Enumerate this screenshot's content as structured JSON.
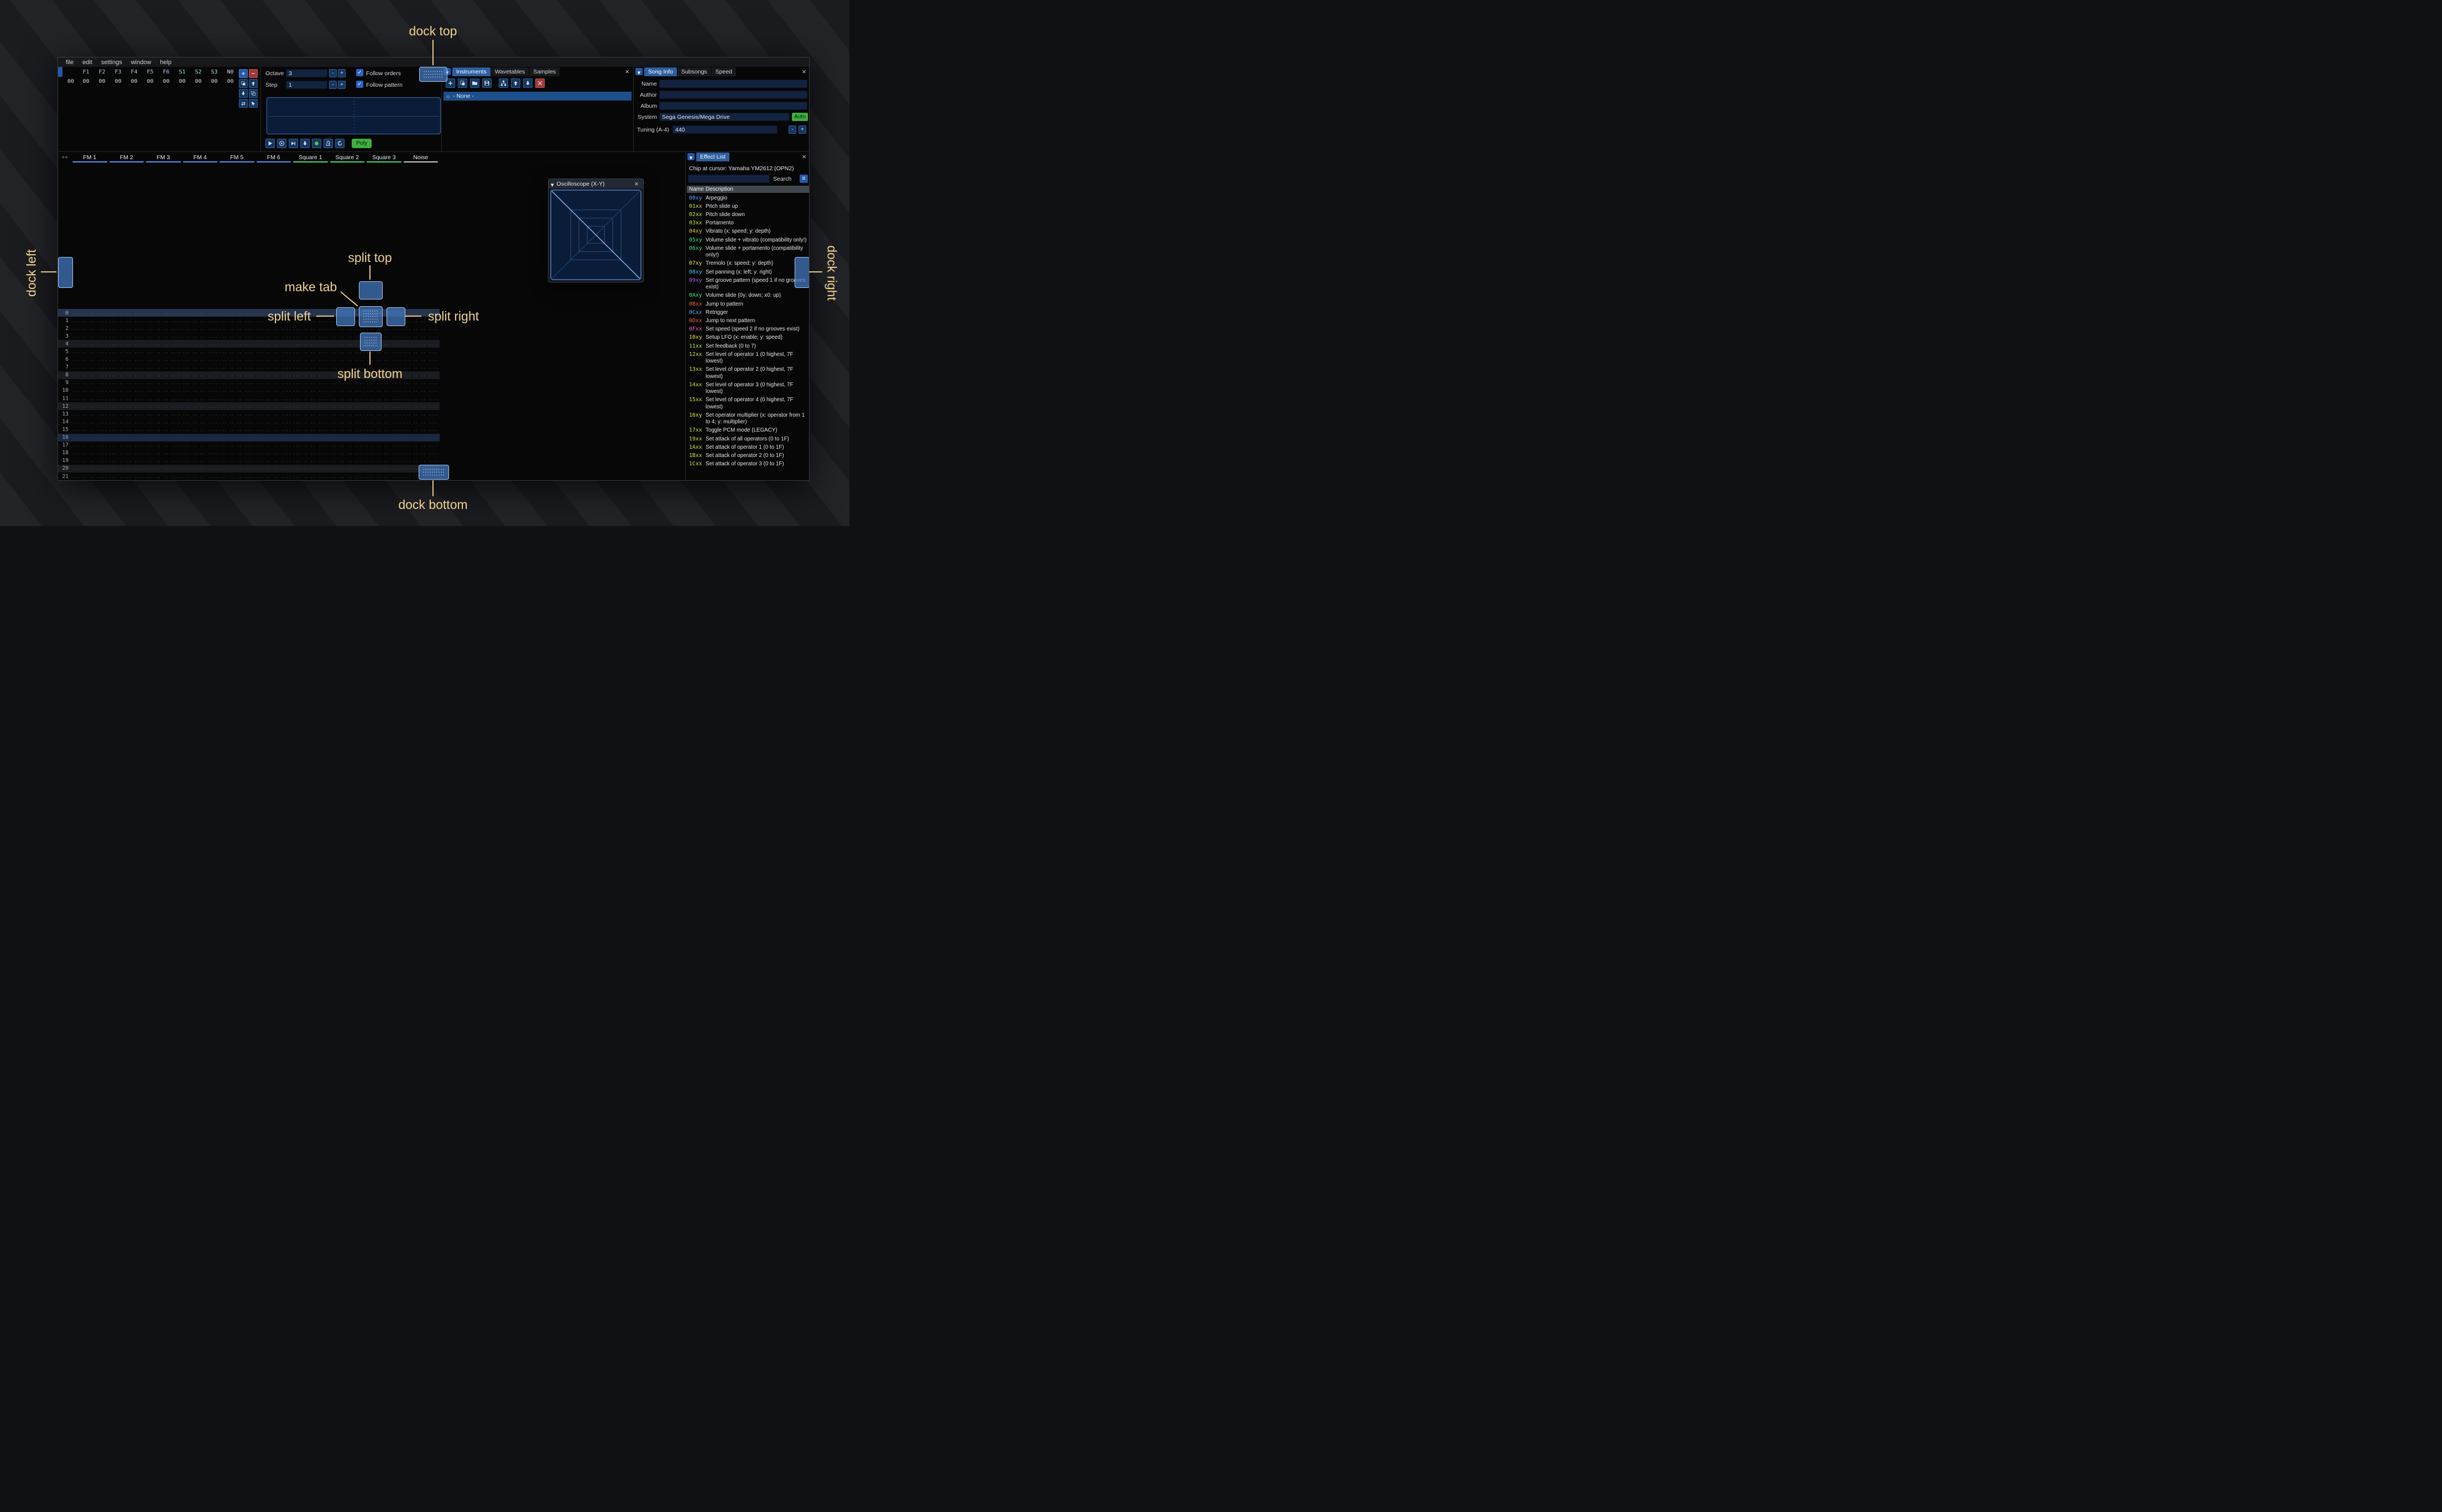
{
  "menu": {
    "items": [
      "file",
      "edit",
      "settings",
      "window",
      "help"
    ]
  },
  "orders": {
    "row_number": "00",
    "channels": [
      {
        "label": "F1",
        "color": "#a8c8f0"
      },
      {
        "label": "F2",
        "color": "#a8c8f0"
      },
      {
        "label": "F3",
        "color": "#a8c8f0"
      },
      {
        "label": "F4",
        "color": "#a8c8f0"
      },
      {
        "label": "F5",
        "color": "#a8c8f0"
      },
      {
        "label": "F6",
        "color": "#a8c8f0"
      },
      {
        "label": "S1",
        "color": "#a8e8c8"
      },
      {
        "label": "S2",
        "color": "#a8e8c8"
      },
      {
        "label": "S3",
        "color": "#a8e8c8"
      },
      {
        "label": "N0",
        "color": "#d0d4d8"
      }
    ],
    "row_values": [
      "00",
      "00",
      "00",
      "00",
      "00",
      "00",
      "00",
      "00",
      "00",
      "00"
    ],
    "buttons": [
      {
        "name": "add-order",
        "icon": "plus",
        "variant": "blue"
      },
      {
        "name": "remove-order",
        "icon": "minus",
        "variant": "red"
      },
      {
        "name": "duplicate-order",
        "icon": "duplicate",
        "variant": "dark"
      },
      {
        "name": "move-order-up",
        "icon": "arrow-up",
        "variant": "dark"
      },
      {
        "name": "move-order-down",
        "icon": "arrow-down",
        "variant": "dark"
      },
      {
        "name": "deep-clone-order",
        "icon": "clone",
        "variant": "dark"
      },
      {
        "name": "order-change-mode",
        "icon": "swap",
        "variant": "dark"
      },
      {
        "name": "order-edit-mode",
        "icon": "cursor",
        "variant": "dark"
      }
    ]
  },
  "transport": {
    "octave_label": "Octave",
    "octave_value": "3",
    "step_label": "Step",
    "step_value": "1",
    "follow_orders_label": "Follow orders",
    "follow_orders_checked": true,
    "follow_pattern_label": "Follow pattern",
    "follow_pattern_checked": true,
    "buttons": [
      {
        "name": "play",
        "icon": "play"
      },
      {
        "name": "play-pattern",
        "icon": "play-circle"
      },
      {
        "name": "play-from-row",
        "icon": "play-bar"
      },
      {
        "name": "step-one-row",
        "icon": "arrow-down"
      },
      {
        "name": "record",
        "icon": "record"
      },
      {
        "name": "metronome",
        "icon": "metronome"
      },
      {
        "name": "repeat-pattern",
        "icon": "repeat"
      }
    ],
    "poly_label": "Poly"
  },
  "instruments": {
    "tabs": [
      {
        "label": "Instruments",
        "active": true
      },
      {
        "label": "Wavetables",
        "active": false
      },
      {
        "label": "Samples",
        "active": false
      }
    ],
    "toolbar": [
      {
        "name": "add-instrument",
        "icon": "plus"
      },
      {
        "name": "duplicate-instrument",
        "icon": "duplicate"
      },
      {
        "name": "open-instrument",
        "icon": "folder"
      },
      {
        "name": "save-instrument",
        "icon": "floppy"
      },
      {
        "name": "instrument-organize",
        "icon": "tree",
        "gap_before": true
      },
      {
        "name": "move-instrument-up",
        "icon": "arrow-up"
      },
      {
        "name": "move-instrument-down",
        "icon": "arrow-down"
      },
      {
        "name": "delete-instrument",
        "icon": "cross",
        "variant": "red"
      }
    ],
    "selected_item": "- None -"
  },
  "song_info": {
    "tabs": [
      {
        "label": "Song Info",
        "active": true
      },
      {
        "label": "Subsongs",
        "active": false
      },
      {
        "label": "Speed",
        "active": false
      }
    ],
    "name_label": "Name",
    "name_value": "",
    "author_label": "Author",
    "author_value": "",
    "album_label": "Album",
    "album_value": "",
    "system_label": "System",
    "system_value": "Sega Genesis/Mega Drive",
    "auto_button": "Auto",
    "tuning_label": "Tuning (A-4)",
    "tuning_value": "440"
  },
  "pattern": {
    "corner_button": "++",
    "channels": [
      {
        "name": "FM 1",
        "color": "#4f9eff"
      },
      {
        "name": "FM 2",
        "color": "#4f9eff"
      },
      {
        "name": "FM 3",
        "color": "#4f9eff"
      },
      {
        "name": "FM 4",
        "color": "#4f9eff"
      },
      {
        "name": "FM 5",
        "color": "#4f9eff"
      },
      {
        "name": "FM 6",
        "color": "#4f9eff"
      },
      {
        "name": "Square 1",
        "color": "#3fe07b"
      },
      {
        "name": "Square 2",
        "color": "#3fe07b"
      },
      {
        "name": "Square 3",
        "color": "#3fe07b"
      },
      {
        "name": "Noise",
        "color": "#c9ced3"
      }
    ],
    "visible_rows": [
      0,
      1,
      2,
      3,
      4,
      5,
      6,
      7,
      8,
      9,
      10,
      11,
      12,
      13,
      14,
      15,
      16,
      17,
      18,
      19,
      20,
      21
    ],
    "empty_cell": "... .. .. ...."
  },
  "oscilloscope": {
    "title": "Oscilloscope (X-Y)"
  },
  "effect_list": {
    "tab_label": "Effect List",
    "chip_line": "Chip at cursor: Yamaha YM2612 (OPN2)",
    "search_label": "Search",
    "columns": [
      "Name",
      "Description"
    ],
    "effects": [
      {
        "code": "00xy",
        "desc": "Arpeggio",
        "color": "#55a6ff"
      },
      {
        "code": "01xx",
        "desc": "Pitch slide up",
        "color": "#c3e63c"
      },
      {
        "code": "02xx",
        "desc": "Pitch slide down",
        "color": "#c3e63c"
      },
      {
        "code": "03xx",
        "desc": "Portamento",
        "color": "#c3e63c"
      },
      {
        "code": "04xy",
        "desc": "Vibrato (x: speed; y: depth)",
        "color": "#e6c83c"
      },
      {
        "code": "05xy",
        "desc": "Volume slide + vibrato (compatibility only!)",
        "color": "#3fe07b"
      },
      {
        "code": "06xy",
        "desc": "Volume slide + portamento (compatibility only!)",
        "color": "#3fe07b"
      },
      {
        "code": "07xy",
        "desc": "Tremolo (x: speed; y: depth)",
        "color": "#e6e63c"
      },
      {
        "code": "08xy",
        "desc": "Set panning (x: left; y: right)",
        "color": "#3fc8e6"
      },
      {
        "code": "09xy",
        "desc": "Set groove pattern (speed 1 if no grooves exist)",
        "color": "#b45ae6"
      },
      {
        "code": "0Axy",
        "desc": "Volume slide (0y: down; x0: up)",
        "color": "#3fe07b"
      },
      {
        "code": "0Bxx",
        "desc": "Jump to pattern",
        "color": "#e6643c"
      },
      {
        "code": "0Cxx",
        "desc": "Retrigger",
        "color": "#55a6ff"
      },
      {
        "code": "0Dxx",
        "desc": "Jump to next pattern",
        "color": "#e6643c"
      },
      {
        "code": "0Fxx",
        "desc": "Set speed (speed 2 if no grooves exist)",
        "color": "#e65ac8"
      },
      {
        "code": "10xy",
        "desc": "Setup LFO (x: enable; y: speed)",
        "color": "#e6e63c"
      },
      {
        "code": "11xx",
        "desc": "Set feedback (0 to 7)",
        "color": "#c3e63c"
      },
      {
        "code": "12xx",
        "desc": "Set level of operator 1 (0 highest, 7F lowest)",
        "color": "#c3e63c"
      },
      {
        "code": "13xx",
        "desc": "Set level of operator 2 (0 highest, 7F lowest)",
        "color": "#c3e63c"
      },
      {
        "code": "14xx",
        "desc": "Set level of operator 3 (0 highest, 7F lowest)",
        "color": "#c3e63c"
      },
      {
        "code": "15xx",
        "desc": "Set level of operator 4 (0 highest, 7F lowest)",
        "color": "#c3e63c"
      },
      {
        "code": "16xy",
        "desc": "Set operator multiplier (x: operator from 1 to 4; y: multiplier)",
        "color": "#e6e63c"
      },
      {
        "code": "17xx",
        "desc": "Toggle PCM mode (LEGACY)",
        "color": "#c3e63c"
      },
      {
        "code": "19xx",
        "desc": "Set attack of all operators (0 to 1F)",
        "color": "#c3e63c"
      },
      {
        "code": "1Axx",
        "desc": "Set attack of operator 1 (0 to 1F)",
        "color": "#c3e63c"
      },
      {
        "code": "1Bxx",
        "desc": "Set attack of operator 2 (0 to 1F)",
        "color": "#c3e63c"
      },
      {
        "code": "1Cxx",
        "desc": "Set attack of operator 3 (0 to 1F)",
        "color": "#c3e63c"
      }
    ]
  },
  "dock": {
    "labels": {
      "top": "dock top",
      "left": "dock left",
      "right": "dock right",
      "bottom": "dock bottom",
      "split_top": "split top",
      "split_left": "split left",
      "split_right": "split right",
      "split_bottom": "split bottom",
      "make_tab": "make tab"
    },
    "overlay_color": "#4478be",
    "label_color": "#f0d28e"
  },
  "colors": {
    "tab_active": "#2d5fa0",
    "selected_row": "#1d4f8c",
    "accent_button": "#2458a8",
    "green_button": "#3fae3f",
    "record_green": "#3fd43f",
    "input_bg": "#13233f",
    "fm_channel": "#4f9eff",
    "square_channel": "#3fe07b",
    "noise_channel": "#c9ced3"
  }
}
